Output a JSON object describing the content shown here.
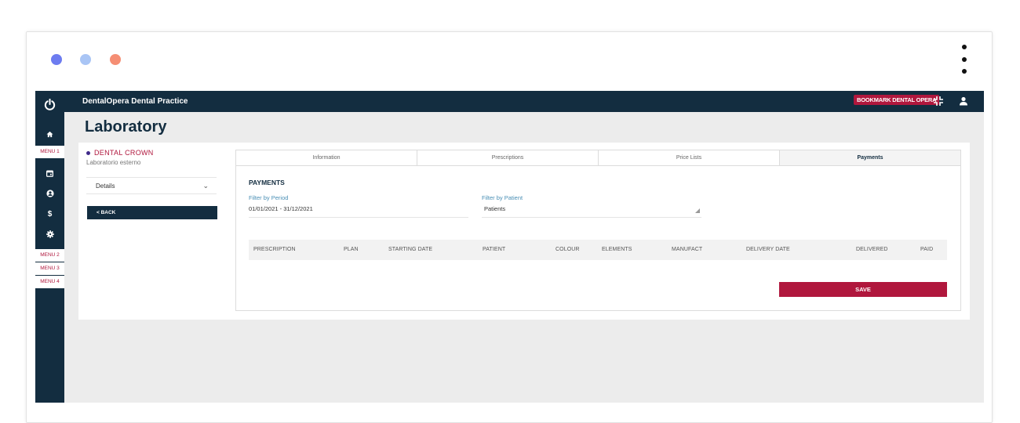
{
  "window": {
    "dots": [
      "#6d7cf0",
      "#a9c5f5",
      "#f58e74"
    ]
  },
  "topbar": {
    "brand": "DentalOpera Dental Practice",
    "bookmark_label": "BOOKMARK DENTAL OPERA"
  },
  "sidebar": {
    "menu1": "MENU 1",
    "menu2": "MENU 2",
    "menu3": "MENU 3",
    "menu4": "MENU 4",
    "icons": [
      "power-icon",
      "home-icon",
      "calendar-icon",
      "user-icon",
      "dollar-icon",
      "gear-icon"
    ]
  },
  "page": {
    "title": "Laboratory"
  },
  "lab": {
    "name": "DENTAL CROWN",
    "subtitle": "Laboratorio esterno",
    "details_label": "Details",
    "back_label": "< BACK"
  },
  "tabs": [
    "Information",
    "Prescriptions",
    "Price Lists",
    "Payments"
  ],
  "payments": {
    "section_title": "PAYMENTS",
    "period_label": "Filter by Period",
    "period_value": "01/01/2021 - 31/12/2021",
    "patient_label": "Filter by Patient",
    "patient_value": "Patients",
    "columns": [
      "PRESCRIPTION",
      "PLAN",
      "STARTING DATE",
      "PATIENT",
      "COLOUR",
      "ELEMENTS",
      "MANUFACT",
      "DELIVERY DATE",
      "DELIVERED",
      "PAID"
    ],
    "save_label": "SAVE"
  },
  "colors": {
    "navy": "#132d40",
    "accent": "#b0173d"
  }
}
